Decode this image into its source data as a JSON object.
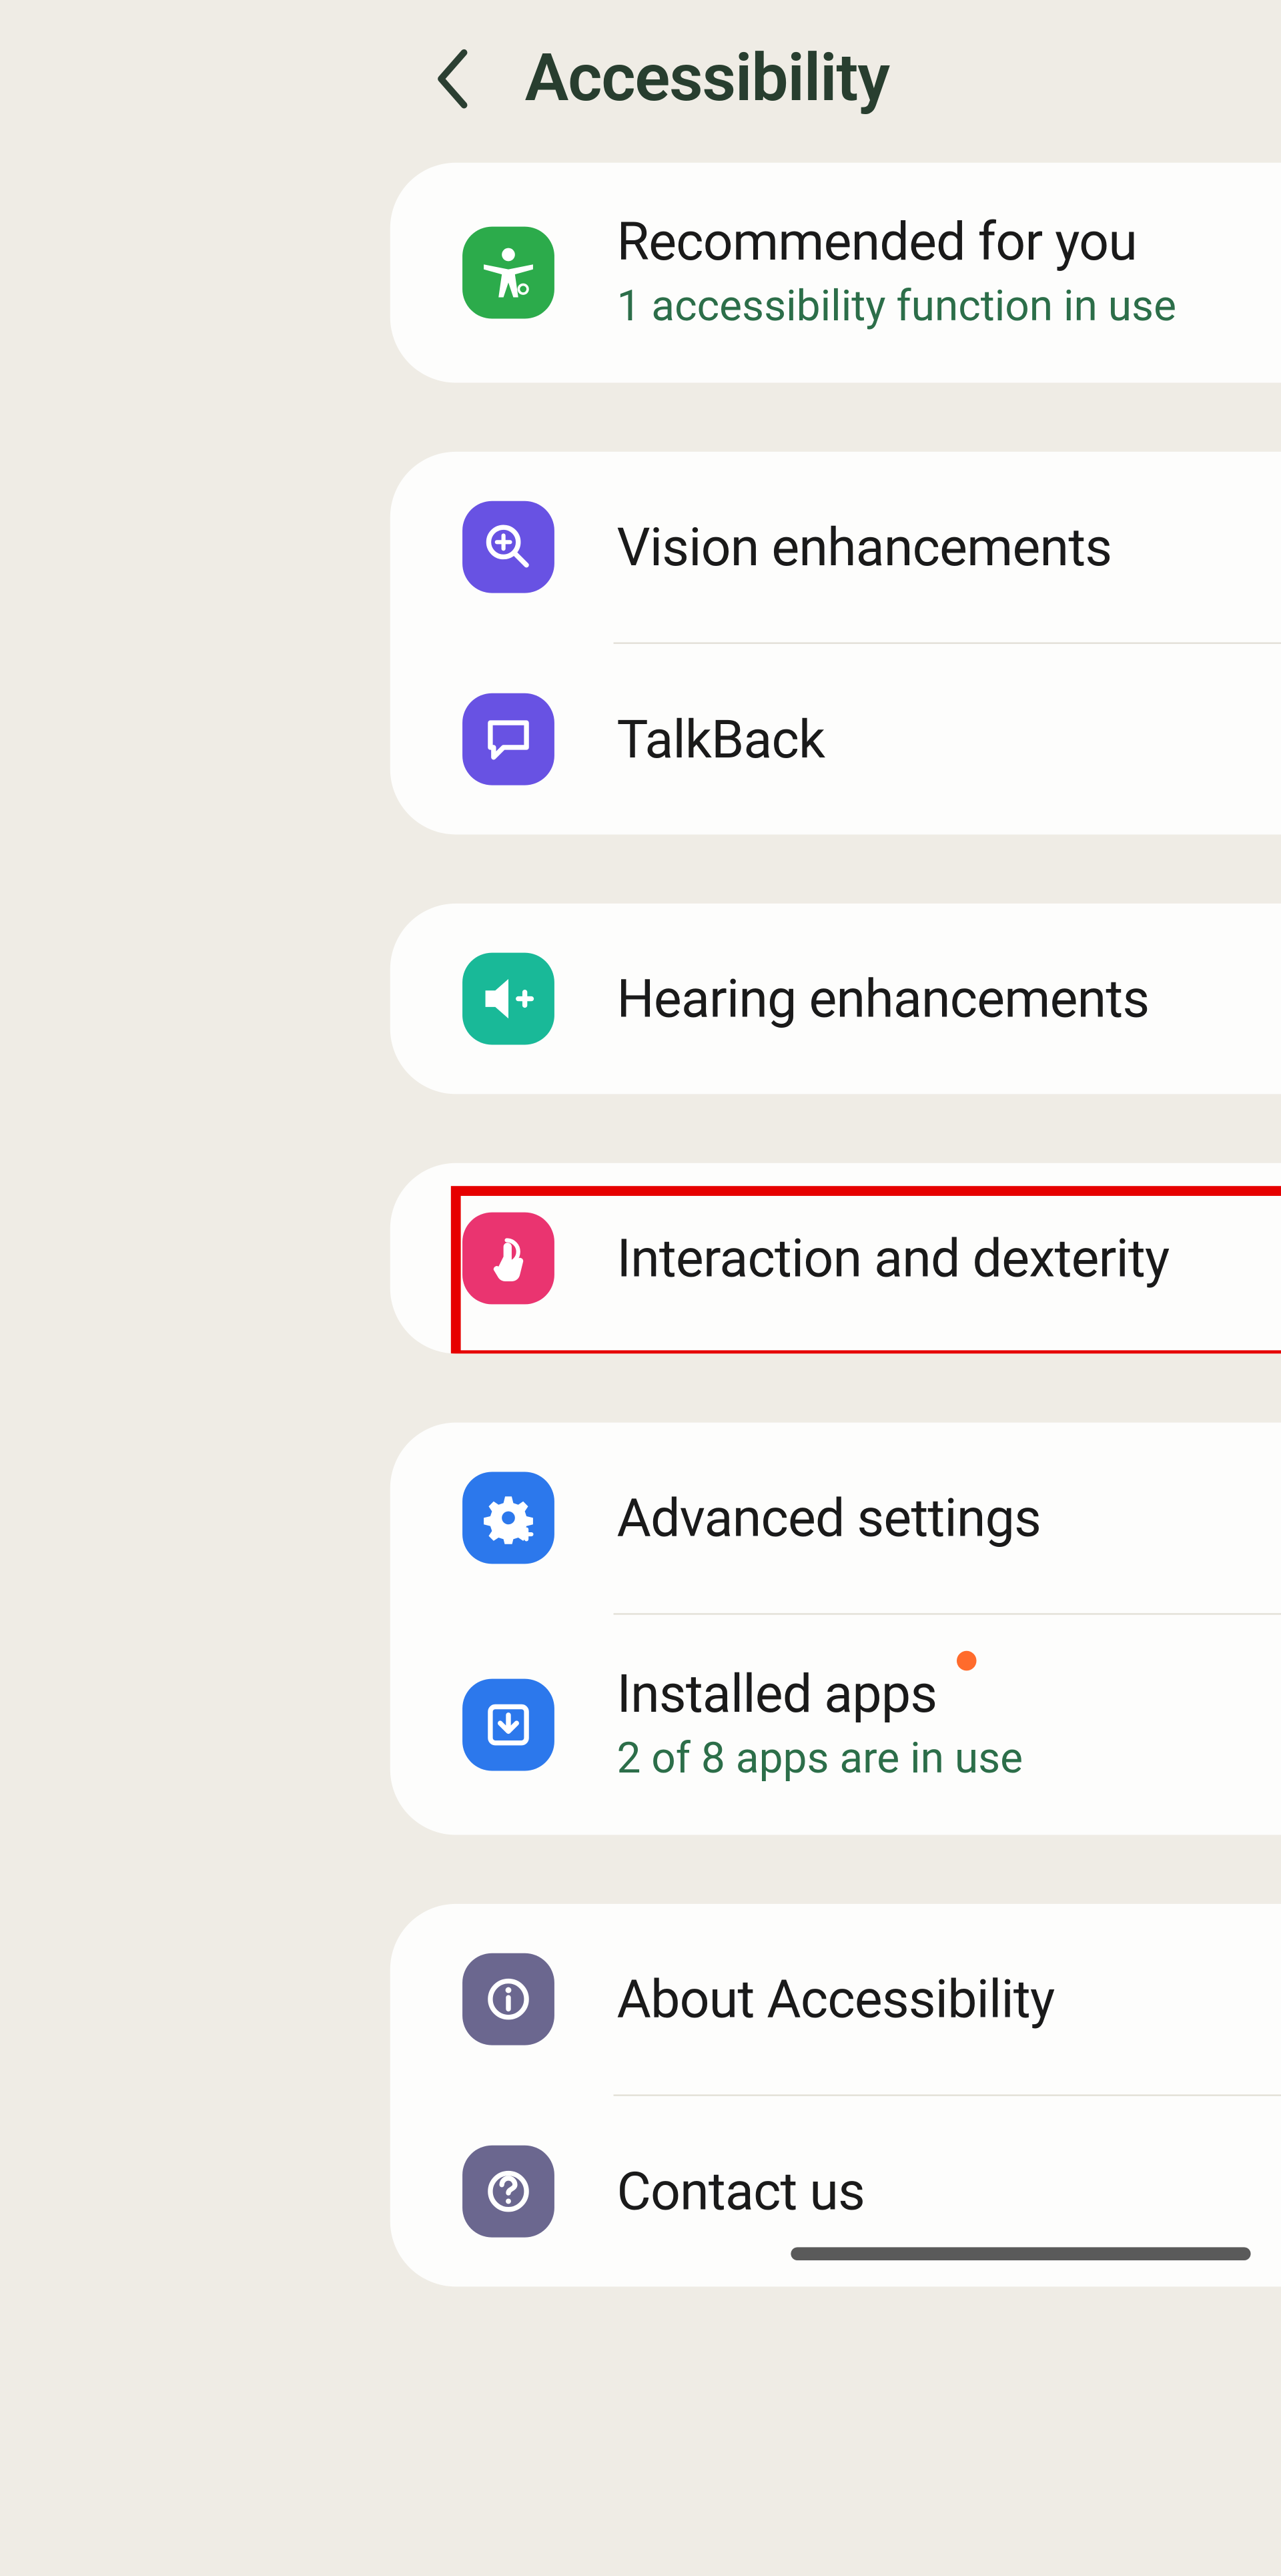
{
  "header": {
    "title": "Accessibility"
  },
  "groups": [
    {
      "items": [
        {
          "key": "recommended",
          "title": "Recommended for you",
          "subtitle": "1 accessibility function in use",
          "icon_color": "squircle-green",
          "icon": "accessibility"
        }
      ]
    },
    {
      "items": [
        {
          "key": "vision",
          "title": "Vision enhancements",
          "icon_color": "squircle-purple",
          "icon": "magnify-plus"
        },
        {
          "key": "talkback",
          "title": "TalkBack",
          "icon_color": "squircle-purple",
          "icon": "chat"
        }
      ]
    },
    {
      "items": [
        {
          "key": "hearing",
          "title": "Hearing enhancements",
          "icon_color": "squircle-teal",
          "icon": "volume-plus"
        }
      ]
    },
    {
      "highlight": true,
      "items": [
        {
          "key": "interaction",
          "title": "Interaction and dexterity",
          "icon_color": "squircle-pink",
          "icon": "touch"
        }
      ]
    },
    {
      "items": [
        {
          "key": "advanced",
          "title": "Advanced settings",
          "icon_color": "squircle-blue",
          "icon": "gear-plus"
        },
        {
          "key": "installed",
          "title": "Installed apps",
          "subtitle": "2 of 8 apps are in use",
          "icon_color": "squircle-blue",
          "icon": "download",
          "dot": true
        }
      ]
    },
    {
      "items": [
        {
          "key": "about",
          "title": "About Accessibility",
          "icon_color": "squircle-slate",
          "icon": "info"
        },
        {
          "key": "contact",
          "title": "Contact us",
          "icon_color": "squircle-slate",
          "icon": "help"
        }
      ]
    }
  ]
}
